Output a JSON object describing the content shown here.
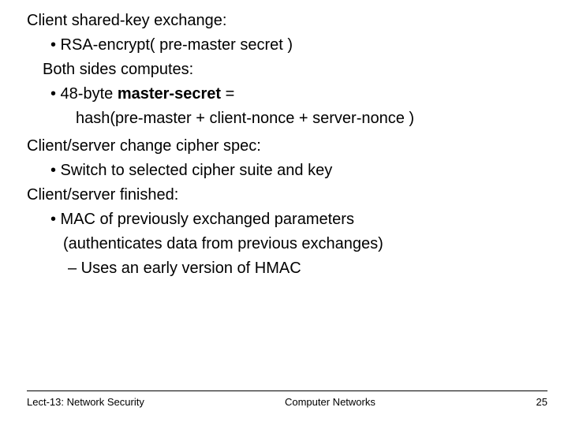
{
  "body": {
    "sec1_title": "Client shared-key exchange:",
    "sec1_b1": "• RSA-encrypt( pre-master secret )",
    "sec1_sub": "Both sides computes:",
    "sec1_b2_pre": "• 48-byte ",
    "sec1_b2_bold": "master-secret",
    "sec1_b2_post": " =",
    "sec1_b3": "hash(pre-master + client-nonce + server-nonce )",
    "sec2_title": "Client/server change cipher spec:",
    "sec2_b1": "• Switch to selected cipher suite and key",
    "sec3_title": "Client/server finished:",
    "sec3_b1": "• MAC of previously exchanged parameters",
    "sec3_b2": "(authenticates data from previous exchanges)",
    "sec3_b3": "– Uses an early version of HMAC"
  },
  "footer": {
    "left": "Lect-13: Network Security",
    "center": "Computer Networks",
    "right": "25"
  }
}
